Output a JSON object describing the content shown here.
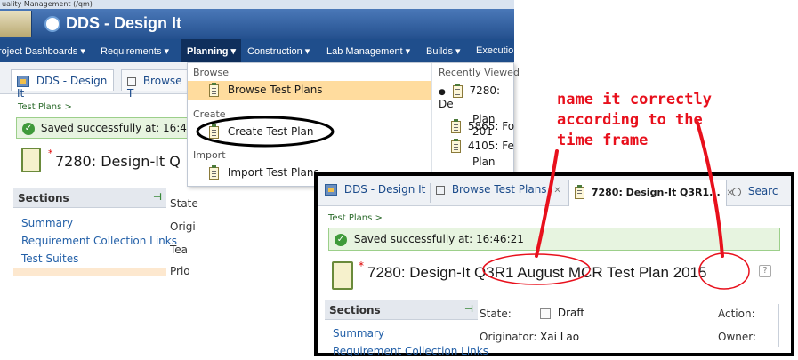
{
  "app": {
    "crumb_top": "uality Management (/qm)",
    "title": "DDS - Design It"
  },
  "nav": {
    "items": [
      "roject Dashboards ▾",
      "Requirements ▾",
      "Planning ▾",
      "Construction ▾",
      "Lab Management ▾",
      "Builds ▾",
      "Executio"
    ]
  },
  "tabs_back": {
    "tab1": "DDS - Design It",
    "tab2": "Browse T"
  },
  "back_page": {
    "breadcrumb": "Test Plans >",
    "saved": "Saved successfully at: 16:46:2",
    "plan_title": "7280: Design-It Q",
    "sections_label": "Sections",
    "links": [
      "Summary",
      "Requirement Collection Links",
      "Test Suites"
    ],
    "side_labels": [
      "State",
      "Origi",
      "Tea",
      "Prio"
    ]
  },
  "menu": {
    "browse_header": "Browse",
    "browse_item": "Browse Test Plans",
    "create_header": "Create",
    "create_item": "Create Test Plan",
    "import_header": "Import",
    "import_item": "Import Test Plans",
    "recent_header": "Recently Viewed",
    "recent": [
      {
        "l1": "7280: De",
        "l2": "Plan 201"
      },
      {
        "l1": "5865: Fo",
        "l2": ""
      },
      {
        "l1": "4105: Fe",
        "l2": "Plan"
      }
    ]
  },
  "annotation": {
    "text1": "name it correctly",
    "text2": "according to the",
    "text3": "time frame"
  },
  "zoom": {
    "tab1": "DDS - Design It",
    "tab2": "Browse Test Plans",
    "tab3": "7280: Design-It Q3R1...",
    "tab4": "Searc",
    "breadcrumb": "Test Plans >",
    "saved": "Saved successfully at: 16:46:21",
    "title_a": "7280: Design-It",
    "title_b": "Q3R1 August",
    "title_c": "MCR Test Plan",
    "title_d": "2015",
    "sections_label": "Sections",
    "links": [
      "Summary",
      "Requirement Collection Links"
    ],
    "state_label": "State:",
    "state_value": "Draft",
    "originator_label": "Originator:",
    "originator_value": "Xai Lao",
    "action_label": "Action:",
    "owner_label": "Owner:",
    "help": "?"
  },
  "colors": {
    "banner": "#2d5a9a",
    "nav": "#1f4e8c",
    "highlight": "#ffdc9e",
    "annotation": "#e8101c"
  }
}
